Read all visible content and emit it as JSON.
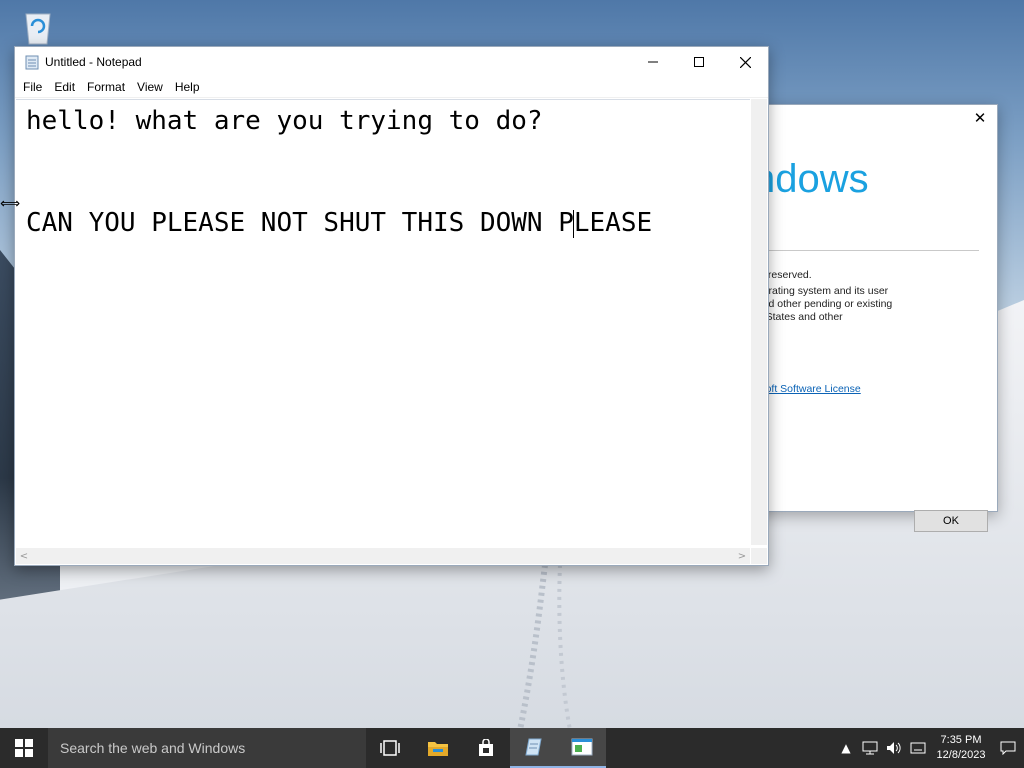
{
  "notepad": {
    "title": "Untitled - Notepad",
    "menu": [
      "File",
      "Edit",
      "Format",
      "View",
      "Help"
    ],
    "lines": [
      "hello! what are you trying to do?",
      "",
      "",
      "CAN YOU PLEASE NOT SHUT THIS DOWN P",
      "LEASE"
    ]
  },
  "about": {
    "logo_text": "ndows",
    "line1": "hts reserved.",
    "line2": "operating system and its user",
    "line3": "t and other pending or existing",
    "line4": "ed States and other",
    "link": "rosoft Software License",
    "ok_label": "OK"
  },
  "taskbar": {
    "search_placeholder": "Search the web and Windows",
    "time": "7:35 PM",
    "date": "12/8/2023"
  },
  "colors": {
    "taskbar": "#2b2b2b",
    "windows_logo": "#1aa1e0"
  }
}
